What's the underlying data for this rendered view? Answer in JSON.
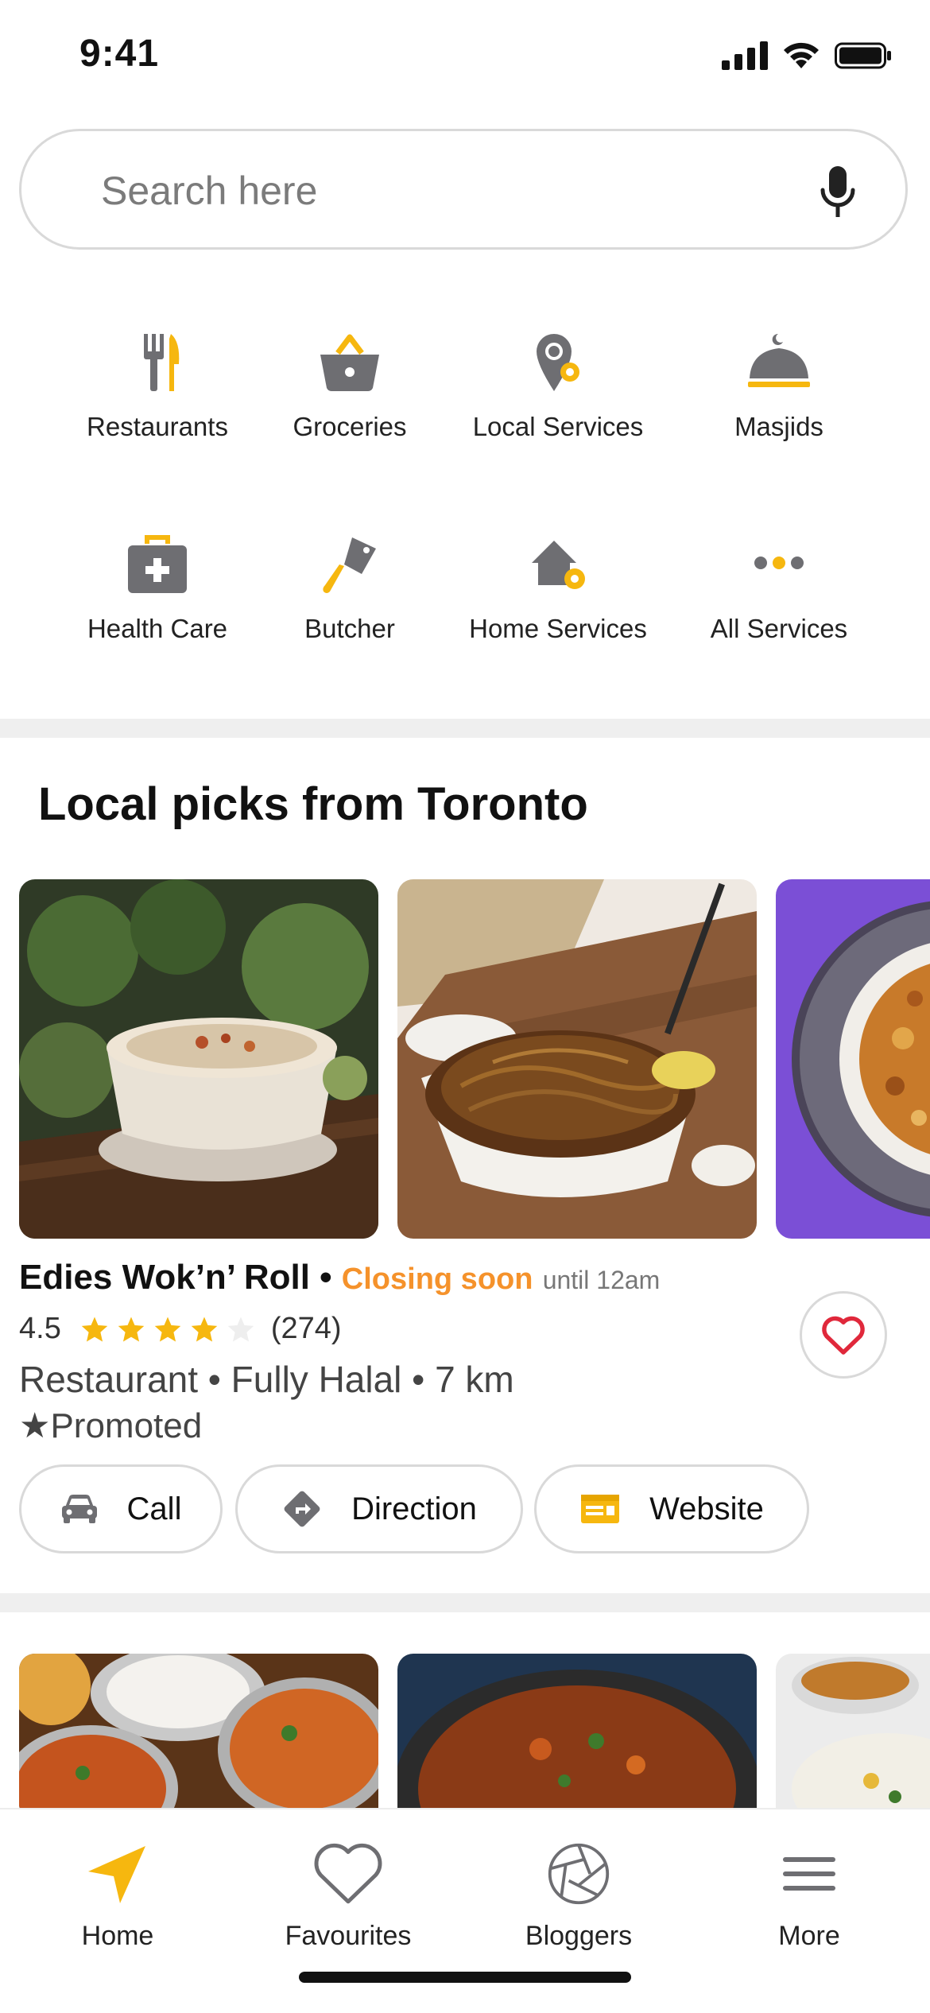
{
  "status_bar": {
    "time": "9:41"
  },
  "search": {
    "placeholder": "Search here"
  },
  "categories": [
    {
      "label": "Restaurants",
      "icon": "fork-knife-icon"
    },
    {
      "label": "Groceries",
      "icon": "basket-icon"
    },
    {
      "label": "Local  Services",
      "icon": "local-services-icon"
    },
    {
      "label": "Masjids",
      "icon": "dome-icon"
    },
    {
      "label": "Health Care",
      "icon": "medical-kit-icon"
    },
    {
      "label": "Butcher",
      "icon": "cleaver-icon"
    },
    {
      "label": "Home  Services",
      "icon": "home-gear-icon"
    },
    {
      "label": "All Services",
      "icon": "more-dots-icon"
    }
  ],
  "section": {
    "title": "Local picks from Toronto"
  },
  "listing": {
    "name": "Edies Wok’n’ Roll",
    "separator": "•",
    "status": "Closing soon",
    "hours": "until 12am",
    "rating": "4.5",
    "stars_filled": 4,
    "stars_total": 5,
    "review_count": "(274)",
    "meta": "Restaurant • Fully Halal • 7 km",
    "promoted": "★Promoted",
    "actions": [
      {
        "label": "Call",
        "icon": "car-icon"
      },
      {
        "label": "Direction",
        "icon": "direction-icon"
      },
      {
        "label": "Website",
        "icon": "website-icon"
      }
    ]
  },
  "bottom_nav": [
    {
      "label": "Home",
      "icon": "navigation-arrow-icon"
    },
    {
      "label": "Favourites",
      "icon": "heart-icon"
    },
    {
      "label": "Bloggers",
      "icon": "aperture-icon"
    },
    {
      "label": "More",
      "icon": "menu-icon"
    }
  ],
  "colors": {
    "accent": "#f6b70f",
    "status_orange": "#f5922b",
    "heart_red": "#e0283b",
    "icon_gray": "#6e6e72",
    "promo_purple": "#7b4fd6"
  }
}
